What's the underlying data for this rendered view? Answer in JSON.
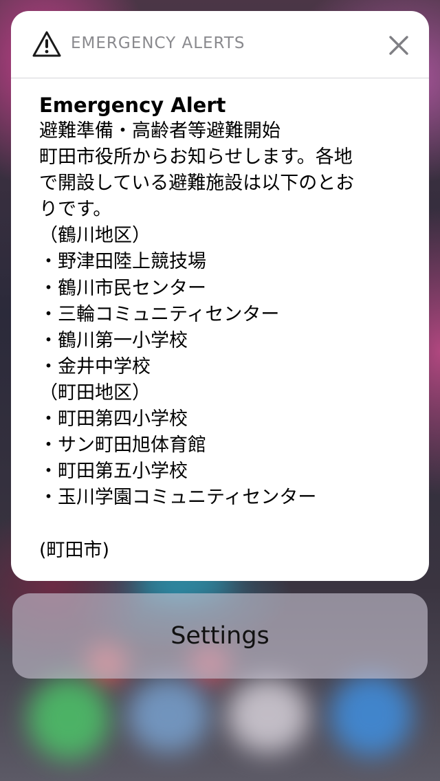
{
  "alert": {
    "header_title": "EMERGENCY ALERTS",
    "title": "Emergency Alert",
    "message": "避難準備・高齢者等避難開始\n町田市役所からお知らせします。各地\nで開設している避難施設は以下のとお\nりです。\n（鶴川地区）\n・野津田陸上競技場\n・鶴川市民センター\n・三輪コミュニティセンター\n・鶴川第一小学校\n・金井中学校\n（町田地区）\n・町田第四小学校\n・サン町田旭体育館\n・町田第五小学校\n・玉川学園コミュニティセンター\n\n(町田市)"
  },
  "settings": {
    "label": "Settings"
  },
  "icons": {
    "warning": "warning-icon",
    "close": "close-icon"
  },
  "colors": {
    "header_text": "#8a8a8e",
    "card_background": "#ffffff",
    "settings_background": "#c8c4d2"
  }
}
